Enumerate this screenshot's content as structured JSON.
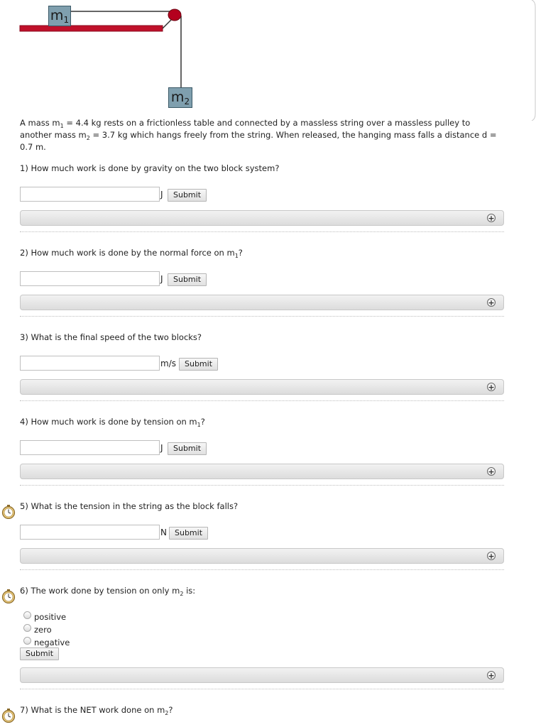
{
  "diagram": {
    "block1_label": "m",
    "block1_sub": "1",
    "block2_label": "m",
    "block2_sub": "2",
    "colors": {
      "table": "#c0102a",
      "block": "#7f9fae",
      "pulley": "#b4001e",
      "string": "#333333"
    }
  },
  "problem": {
    "p1": "A mass m",
    "s1": "1",
    "p2": " = 4.4 kg rests on a frictionless table and connected by a massless string over a massless pulley to another mass m",
    "s2": "2",
    "p3": " = 3.7 kg which hangs freely from the string. When released, the hanging mass falls a distance d = 0.7 m."
  },
  "questions": [
    {
      "number": "1)",
      "text": "How much work is done by gravity on the two block system?",
      "sub": "",
      "after": "",
      "unit": "J",
      "submit": "Submit",
      "input_value": "",
      "timed": false
    },
    {
      "number": "2)",
      "text": "How much work is done by the normal force on m",
      "sub": "1",
      "after": "?",
      "unit": "J",
      "submit": "Submit",
      "input_value": "",
      "timed": false
    },
    {
      "number": "3)",
      "text": "What is the final speed of the two blocks?",
      "sub": "",
      "after": "",
      "unit": "m/s",
      "submit": "Submit",
      "input_value": "",
      "timed": false
    },
    {
      "number": "4)",
      "text": "How much work is done by tension on m",
      "sub": "1",
      "after": "?",
      "unit": "J",
      "submit": "Submit",
      "input_value": "",
      "timed": false
    },
    {
      "number": "5)",
      "text": "What is the tension in the string as the block falls?",
      "sub": "",
      "after": "",
      "unit": "N",
      "submit": "Submit",
      "input_value": "",
      "timed": true
    },
    {
      "number": "6)",
      "text": "The work done by tension on only m",
      "sub": "2",
      "after": " is:",
      "options": [
        "positive",
        "zero",
        "negative"
      ],
      "selected": null,
      "submit": "Submit",
      "timed": true
    },
    {
      "number": "7)",
      "text": "What is the NET work done on m",
      "sub": "2",
      "after": "?",
      "timed": true
    }
  ],
  "icons": {
    "expand": "plus-circle-icon",
    "timer": "stopwatch-icon"
  }
}
